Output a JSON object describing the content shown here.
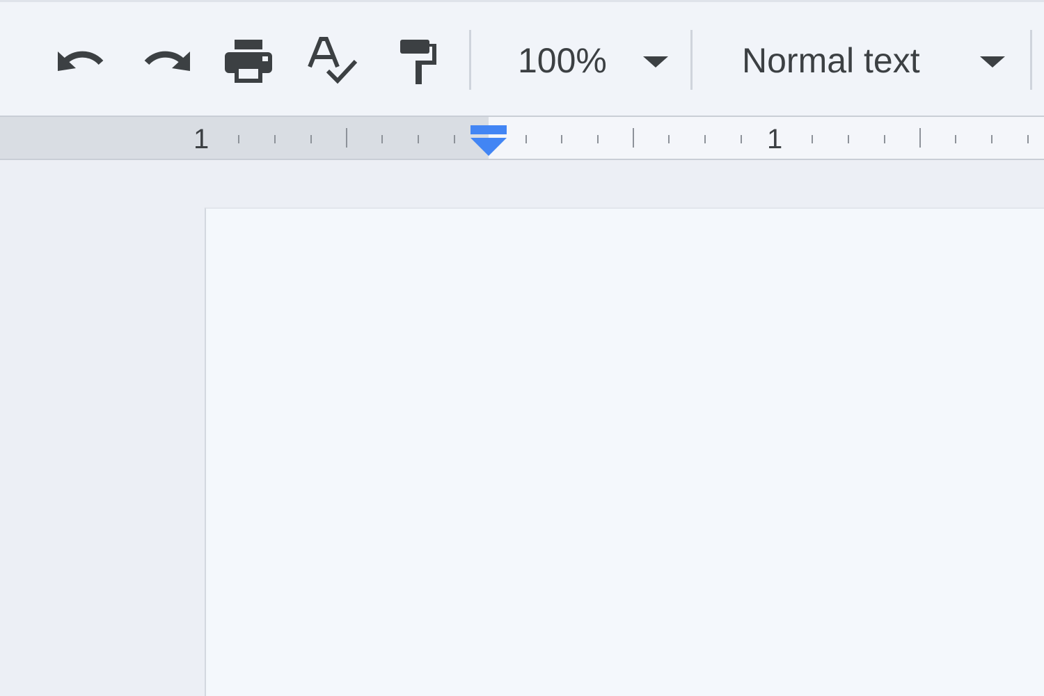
{
  "toolbar": {
    "undo_icon": "undo-icon",
    "redo_icon": "redo-icon",
    "print_icon": "print-icon",
    "spellcheck_icon": "spellcheck-icon",
    "paint_format_icon": "paint-format-icon",
    "zoom_value": "100%",
    "style_value": "Normal text"
  },
  "ruler": {
    "labels": [
      "1",
      "1"
    ],
    "indent_marker_color": "#4285f4"
  },
  "colors": {
    "icon": "#3c4043",
    "accent": "#4285f4"
  }
}
